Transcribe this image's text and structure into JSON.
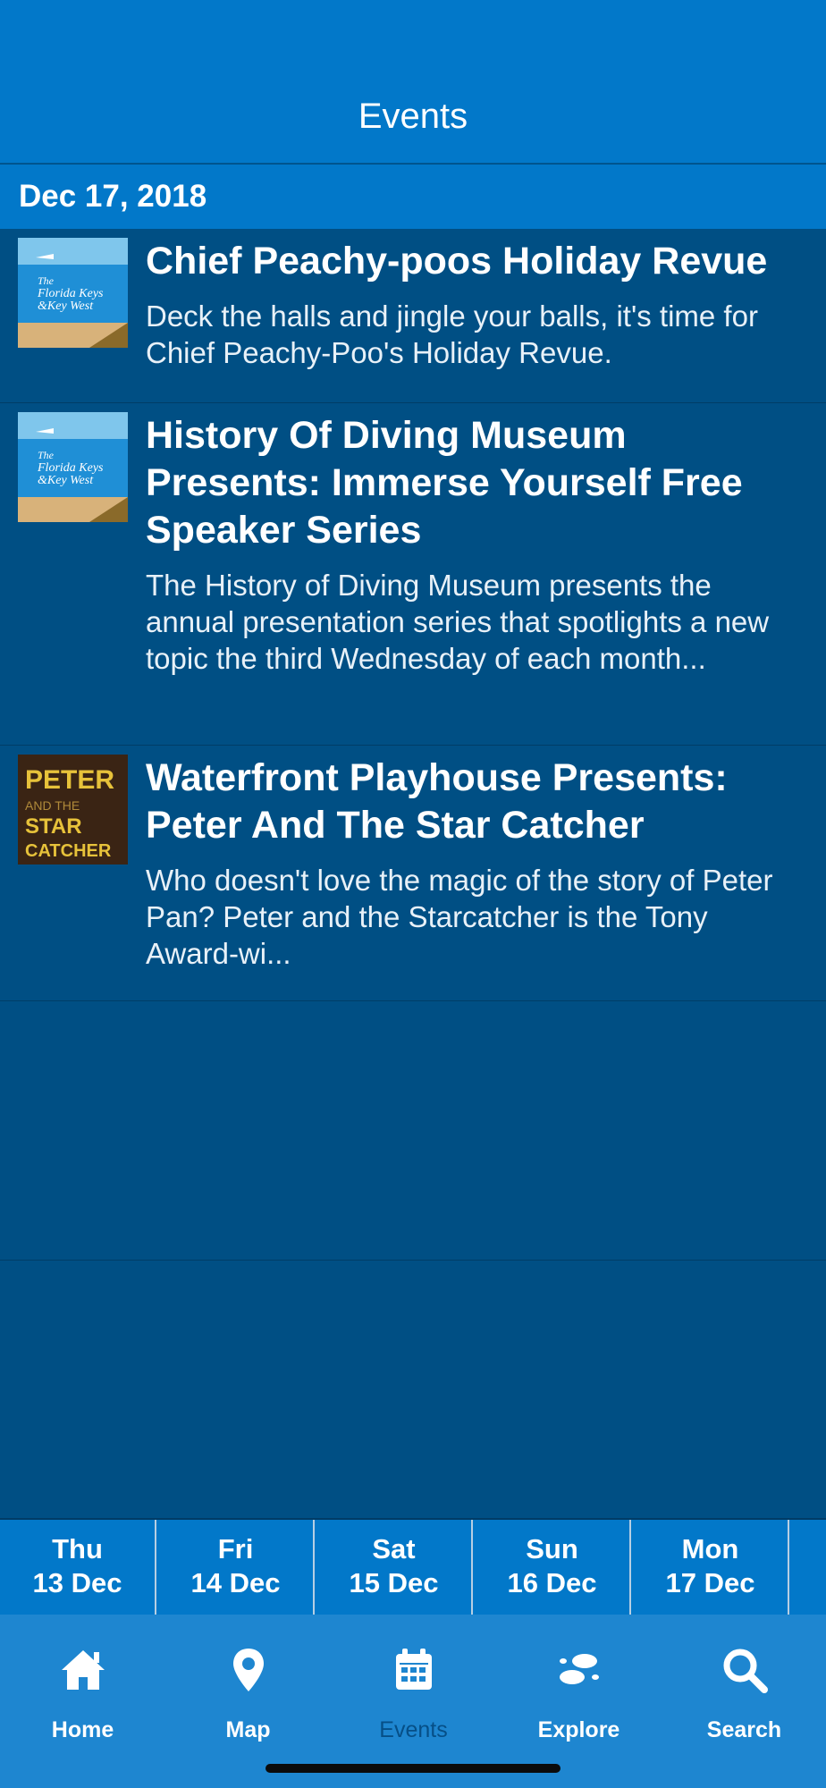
{
  "header": {
    "title": "Events"
  },
  "section": {
    "date": "Dec 17, 2018"
  },
  "events": [
    {
      "title": "Chief Peachy-poos Holiday Revue",
      "description": "Deck the halls and jingle your balls, it's time for Chief Peachy-Poo's Holiday Revue.",
      "thumb_text": "The Florida Keys & Key West"
    },
    {
      "title": "History Of Diving Museum Presents: Immerse Yourself Free Speaker Series",
      "description": "The History of Diving Museum presents the annual presentation series that spotlights a new topic the third Wednesday of each month...",
      "thumb_text": "The Florida Keys & Key West"
    },
    {
      "title": "Waterfront Playhouse Presents: Peter And The Star Catcher",
      "description": "Who doesn't love the magic of the story of Peter Pan? Peter and the Starcatcher is the Tony Award-wi...",
      "thumb_text": "PETER AND THE STAR CATCHER"
    }
  ],
  "days": [
    {
      "weekday": "Thu",
      "date": "13 Dec"
    },
    {
      "weekday": "Fri",
      "date": "14 Dec"
    },
    {
      "weekday": "Sat",
      "date": "15 Dec"
    },
    {
      "weekday": "Sun",
      "date": "16 Dec"
    },
    {
      "weekday": "Mon",
      "date": "17 Dec"
    }
  ],
  "tabs": [
    {
      "label": "Home",
      "icon": "home-icon"
    },
    {
      "label": "Map",
      "icon": "map-pin-icon"
    },
    {
      "label": "Events",
      "icon": "calendar-icon",
      "active": true
    },
    {
      "label": "Explore",
      "icon": "footprints-icon"
    },
    {
      "label": "Search",
      "icon": "search-icon"
    }
  ],
  "colors": {
    "header_blue": "#0278c9",
    "list_background": "#004f84",
    "tabbar_blue": "#1e86d0",
    "active_tab_label": "#064f87"
  }
}
